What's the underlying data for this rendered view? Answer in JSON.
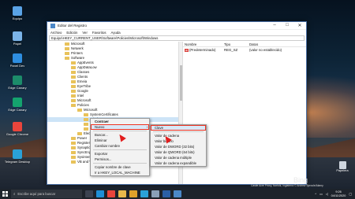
{
  "desktop": {
    "icons": [
      {
        "label": "Equipo",
        "color": "#5aa3e6",
        "icon": "computer-icon"
      },
      {
        "label": "Papel",
        "color": "#7bb4e8",
        "icon": "folder-icon"
      },
      {
        "label": "Panel Dev",
        "color": "#2e8ee0",
        "icon": "control-panel-icon"
      },
      {
        "label": "Edge Canary",
        "color": "#1c8c6a",
        "icon": "edge-canary-icon"
      },
      {
        "label": "Edge Canary",
        "color": "#14a36e",
        "icon": "edge-icon"
      },
      {
        "label": "Google Chrome",
        "color": "#e9453c",
        "icon": "chrome-icon"
      },
      {
        "label": "Telegram Desktop",
        "color": "#2aa1d8",
        "icon": "telegram-icon"
      }
    ],
    "recycle_bin": "Papelera"
  },
  "window": {
    "title": "Editor del Registro",
    "menu": [
      "Archivo",
      "Edición",
      "Ver",
      "Favoritos",
      "Ayuda"
    ],
    "address": "Equipo\\HKEY_CURRENT_USER\\Software\\Policies\\Microsoft\\Windows",
    "tree": [
      {
        "label": "Microsoft",
        "indent": 0
      },
      {
        "label": "Netwerk",
        "indent": 0
      },
      {
        "label": "Printers",
        "indent": 0
      },
      {
        "label": "Software",
        "indent": 0
      },
      {
        "label": "AppEvents",
        "indent": 1
      },
      {
        "label": "AppDataLow",
        "indent": 1
      },
      {
        "label": "Classes",
        "indent": 1
      },
      {
        "label": "Clients",
        "indent": 1
      },
      {
        "label": "Emeia",
        "indent": 1
      },
      {
        "label": "EyeTribe",
        "indent": 1
      },
      {
        "label": "Google",
        "indent": 1
      },
      {
        "label": "Intel",
        "indent": 1
      },
      {
        "label": "Microsoft",
        "indent": 1
      },
      {
        "label": "Policies",
        "indent": 1
      },
      {
        "label": "Microsoft",
        "indent": 2
      },
      {
        "label": "SystemCertificates",
        "indent": 3
      },
      {
        "label": "Windows",
        "indent": 3,
        "selected": true
      },
      {
        "label": "Chr",
        "indent": 3
      },
      {
        "label": "Cur",
        "indent": 3
      },
      {
        "label": "Elec",
        "indent": 2
      },
      {
        "label": "Power",
        "indent": 1
      },
      {
        "label": "RegisteredAp",
        "indent": 1
      },
      {
        "label": "Synaptics",
        "indent": 1
      },
      {
        "label": "SyncEngines",
        "indent": 1
      },
      {
        "label": "Sysinternals",
        "indent": 1
      },
      {
        "label": "VB and VBA P",
        "indent": 1
      }
    ],
    "columns": [
      "Nombre",
      "Tipo",
      "Datos"
    ],
    "rows": [
      {
        "name": "(Predeterminado)",
        "type": "REG_SZ",
        "data": "(valor no establecido)"
      }
    ]
  },
  "context_menu": {
    "items": [
      "Contraer",
      "Nuevo",
      "Buscar...",
      "Eliminar",
      "Cambiar nombre",
      "Exportar",
      "Permisos...",
      "Copiar nombre de clave",
      "Ir a HKEY_LOCAL_MACHINE"
    ],
    "highlighted": "Nuevo",
    "submenu_arrow": "›"
  },
  "submenu": {
    "items": [
      "Clave",
      "Valor de cadena",
      "Valor binario",
      "Valor de DWORD (32 bits)",
      "Valor de QWORD (64 bits)",
      "Valor de cadena múltiple",
      "Valor de cadena expandible"
    ],
    "highlighted": "Clave"
  },
  "taskbar": {
    "search_placeholder": "Escribe aquí para buscar",
    "time": "9:26",
    "date": "04/11/2020",
    "apps": [
      {
        "icon": "task-view-icon",
        "color": "#3b4250"
      },
      {
        "icon": "edge-icon",
        "color": "#1f8fd6"
      },
      {
        "icon": "chrome-icon",
        "color": "#e9453c"
      },
      {
        "icon": "explorer-icon",
        "color": "#e8b84b"
      },
      {
        "icon": "edge-canary-icon",
        "color": "#e0a12a"
      },
      {
        "icon": "telegram-icon",
        "color": "#2aa1d8"
      },
      {
        "icon": "settings-icon",
        "color": "#8aa0b8"
      },
      {
        "icon": "terminal-icon",
        "color": "#2b5fa5"
      },
      {
        "icon": "registry-icon",
        "color": "#4b88c8"
      }
    ]
  },
  "wallpaper": {
    "brand": "Bing",
    "caption": "Castle Acre Priory, Norfolk, Inglaterra © Andrew Sproule/Alamy"
  }
}
